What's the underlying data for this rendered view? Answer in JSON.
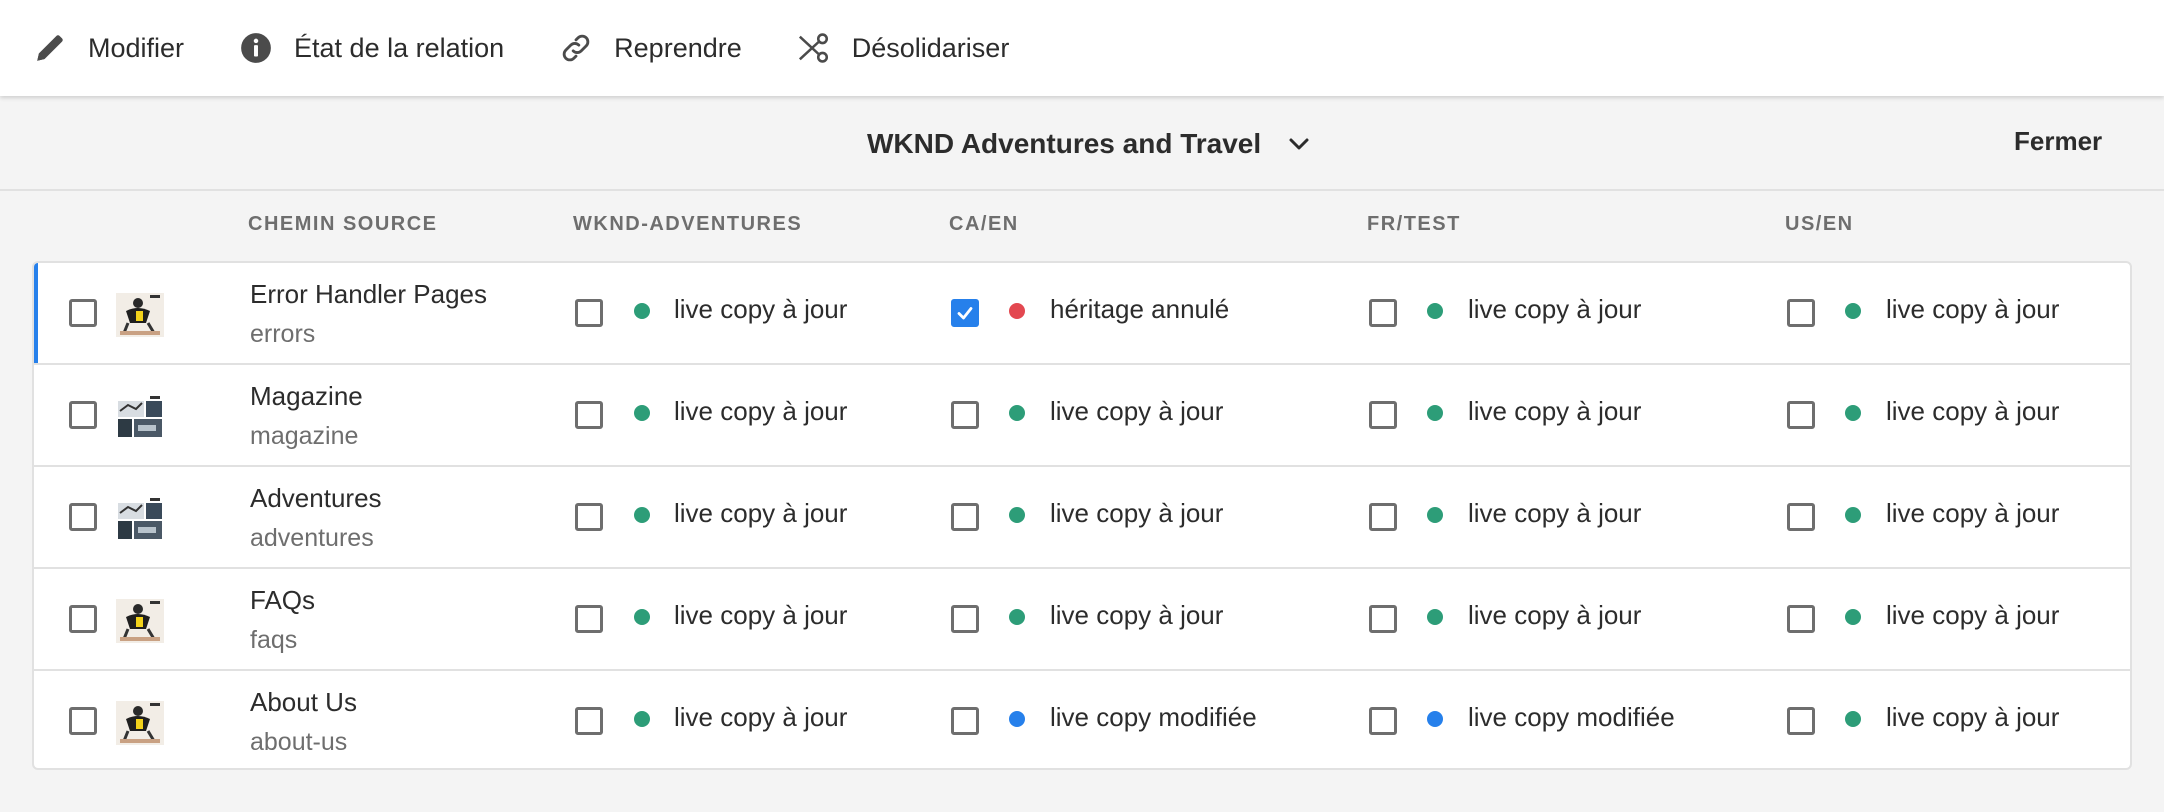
{
  "actionbar": {
    "items": [
      {
        "label": "Modifier",
        "icon": "pencil-icon"
      },
      {
        "label": "État de la relation",
        "icon": "info-icon"
      },
      {
        "label": "Reprendre",
        "icon": "link-icon"
      },
      {
        "label": "Désolidariser",
        "icon": "scissors-icon"
      }
    ]
  },
  "header": {
    "site": "WKND Adventures and Travel",
    "close_label": "Fermer"
  },
  "columns": [
    "CHEMIN SOURCE",
    "WKND-ADVENTURES",
    "CA/EN",
    "FR/TEST",
    "US/EN"
  ],
  "colors": {
    "up_to_date": "#2d9d78",
    "cancelled": "#e34850",
    "modified": "#2680eb",
    "accent": "#2680eb"
  },
  "rows": [
    {
      "title": "Error Handler Pages",
      "path": "errors",
      "selected": true,
      "cells": [
        {
          "text": "live copy à jour",
          "status": "up_to_date",
          "checked": false
        },
        {
          "text": "héritage annulé",
          "status": "cancelled",
          "checked": true
        },
        {
          "text": "live copy à jour",
          "status": "up_to_date",
          "checked": false
        },
        {
          "text": "live copy à jour",
          "status": "up_to_date",
          "checked": false
        }
      ]
    },
    {
      "title": "Magazine",
      "path": "magazine",
      "selected": false,
      "cells": [
        {
          "text": "live copy à jour",
          "status": "up_to_date",
          "checked": false
        },
        {
          "text": "live copy à jour",
          "status": "up_to_date",
          "checked": false
        },
        {
          "text": "live copy à jour",
          "status": "up_to_date",
          "checked": false
        },
        {
          "text": "live copy à jour",
          "status": "up_to_date",
          "checked": false
        }
      ]
    },
    {
      "title": "Adventures",
      "path": "adventures",
      "selected": false,
      "cells": [
        {
          "text": "live copy à jour",
          "status": "up_to_date",
          "checked": false
        },
        {
          "text": "live copy à jour",
          "status": "up_to_date",
          "checked": false
        },
        {
          "text": "live copy à jour",
          "status": "up_to_date",
          "checked": false
        },
        {
          "text": "live copy à jour",
          "status": "up_to_date",
          "checked": false
        }
      ]
    },
    {
      "title": "FAQs",
      "path": "faqs",
      "selected": false,
      "cells": [
        {
          "text": "live copy à jour",
          "status": "up_to_date",
          "checked": false
        },
        {
          "text": "live copy à jour",
          "status": "up_to_date",
          "checked": false
        },
        {
          "text": "live copy à jour",
          "status": "up_to_date",
          "checked": false
        },
        {
          "text": "live copy à jour",
          "status": "up_to_date",
          "checked": false
        }
      ]
    },
    {
      "title": "About Us",
      "path": "about-us",
      "selected": false,
      "cells": [
        {
          "text": "live copy à jour",
          "status": "up_to_date",
          "checked": false
        },
        {
          "text": "live copy modifiée",
          "status": "modified",
          "checked": false
        },
        {
          "text": "live copy modifiée",
          "status": "modified",
          "checked": false
        },
        {
          "text": "live copy à jour",
          "status": "up_to_date",
          "checked": false
        }
      ]
    }
  ]
}
